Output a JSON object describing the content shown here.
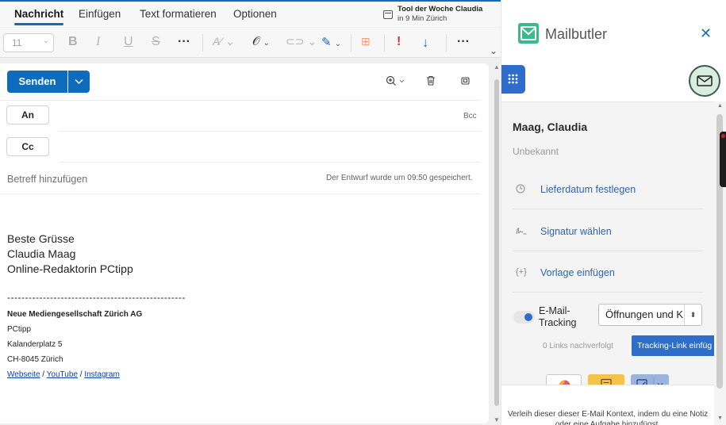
{
  "ribbon": {
    "tabs": [
      "Nachricht",
      "Einfügen",
      "Text formatieren",
      "Optionen"
    ],
    "active_tab": "Nachricht",
    "tool_of_week": {
      "title": "Tool der Woche Claudia",
      "subtitle": "in 9 Min Zürich"
    },
    "font_size": "11",
    "tools": [
      "bold",
      "italic",
      "underline",
      "strikethrough",
      "more",
      "highlight",
      "attach",
      "link",
      "pen",
      "template",
      "importance",
      "low-priority",
      "more"
    ]
  },
  "compose": {
    "send_label": "Senden",
    "to_label": "An",
    "cc_label": "Cc",
    "bcc_label": "Bcc",
    "subject_placeholder": "Betreff hinzufügen",
    "draft_saved": "Der Entwurf wurde um 09:50 gespeichert.",
    "body_lines": [
      "Beste Grüsse",
      "Claudia Maag",
      "Online-Redaktorin PCtipp"
    ],
    "separator": "--------------------------------------------------",
    "signature": {
      "company": "Neue Mediengesellschaft Zürich AG",
      "lines": [
        "PCtipp",
        "Kalanderplatz 5",
        "CH-8045 Zürich"
      ],
      "links": [
        "Webseite",
        "YouTube",
        "Instagram"
      ],
      "link_sep": " / "
    }
  },
  "panel": {
    "brand": "Mailbutler",
    "brand_color": "#3db88a",
    "accent_color": "#2f6dcb",
    "contact_name": "Maag, Claudia",
    "contact_status": "Unbekannt",
    "actions": [
      {
        "icon": "clock-icon",
        "label": "Lieferdatum festlegen"
      },
      {
        "icon": "signature-icon",
        "label": "Signatur wählen"
      },
      {
        "icon": "template-icon",
        "label": "Vorlage einfügen"
      }
    ],
    "tracking": {
      "label": "E-Mail-Tracking",
      "enabled": true,
      "select_value": "Öffnungen und K",
      "links_count": "0 Links nachverfolgt",
      "button_label": "Tracking-Link einfüg"
    },
    "bottom_text": "Verleih dieser dieser E-Mail Kontext, indem du eine Notiz oder eine Aufgabe hinzufügst."
  }
}
